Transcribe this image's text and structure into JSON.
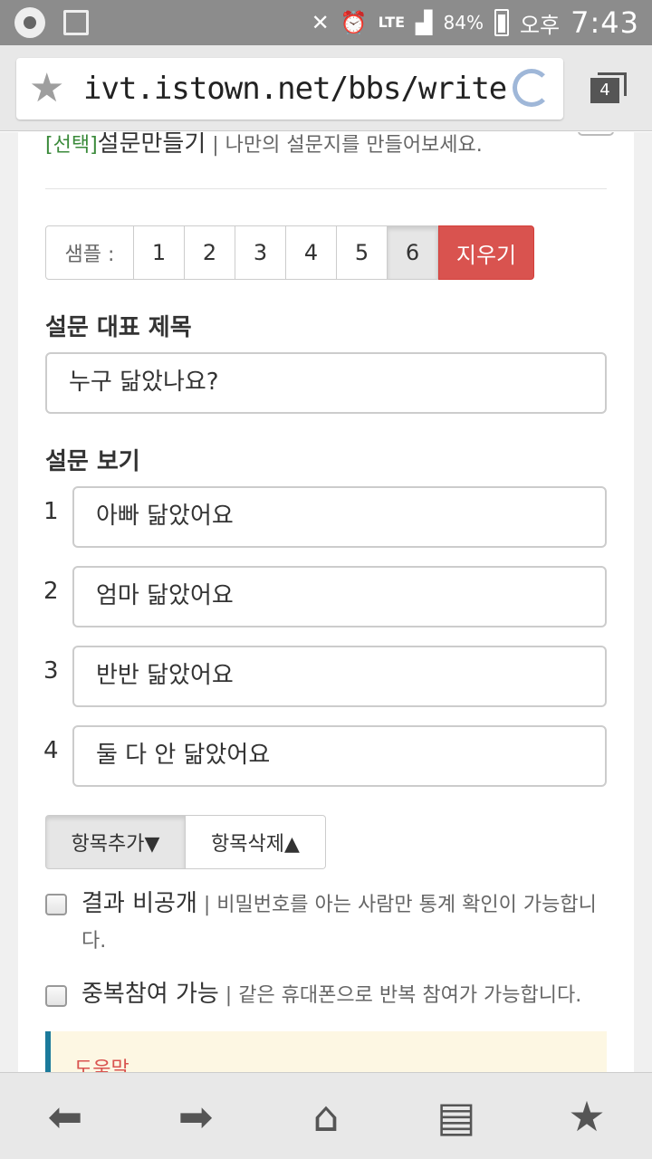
{
  "status_bar": {
    "battery_pct": "84%",
    "network": "LTE",
    "period": "오후",
    "time": "7:43"
  },
  "browser": {
    "url": "ivt.istown.net/bbs/write.ph",
    "tab_count": "4"
  },
  "header_row": {
    "tag": "[선택]",
    "title": "설문만들기",
    "desc": "| 나만의 설문지를 만들어보세요."
  },
  "samples": {
    "label": "샘플 :",
    "buttons": [
      "1",
      "2",
      "3",
      "4",
      "5",
      "6"
    ],
    "active": "6",
    "clear_label": "지우기"
  },
  "survey": {
    "title_heading": "설문 대표 제목",
    "title_value": "누구 닮았나요?",
    "options_heading": "설문 보기",
    "options": [
      {
        "num": "1",
        "value": "아빠 닮았어요"
      },
      {
        "num": "2",
        "value": "엄마 닮았어요"
      },
      {
        "num": "3",
        "value": "반반 닮았어요"
      },
      {
        "num": "4",
        "value": "둘 다 안 닮았어요"
      }
    ]
  },
  "item_buttons": {
    "add": "항목추가▼",
    "delete": "항목삭제▲"
  },
  "checkboxes": {
    "private": {
      "label": "결과 비공개",
      "desc": "| 비밀번호를 아는 사람만 통계 확인이 가능합니다."
    },
    "multi": {
      "label": "중복참여 가능",
      "desc": "| 같은 휴대폰으로 반복 참여가 가능합니다."
    }
  },
  "help": {
    "title": "도움말"
  },
  "colors": {
    "danger": "#d9534f",
    "help_border": "#1b7a9b",
    "help_bg": "#fdf7e3",
    "status_bar": "#8c8c8c"
  }
}
